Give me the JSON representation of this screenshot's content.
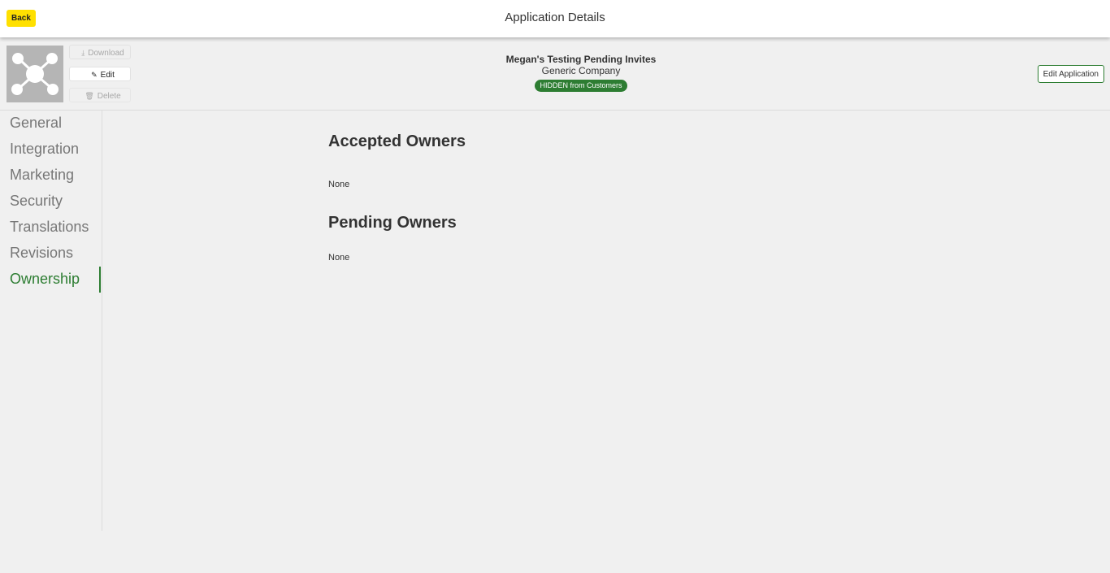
{
  "topbar": {
    "back_label": "Back",
    "title": "Application Details"
  },
  "app": {
    "logo_icon": "network-nodes-icon",
    "name": "Megan's Testing Pending Invites",
    "company": "Generic Company",
    "status": "HIDDEN from Customers",
    "download_label": "Download",
    "edit_label": "Edit",
    "delete_label": "Delete",
    "edit_application_label": "Edit Application"
  },
  "sidebar": {
    "items": [
      {
        "label": "General"
      },
      {
        "label": "Integration"
      },
      {
        "label": "Marketing"
      },
      {
        "label": "Security"
      },
      {
        "label": "Translations"
      },
      {
        "label": "Revisions"
      },
      {
        "label": "Ownership"
      }
    ],
    "active": "Ownership"
  },
  "ownership": {
    "accepted_heading": "Accepted Owners",
    "accepted_value": "None",
    "pending_heading": "Pending Owners",
    "pending_value": "None"
  },
  "colors": {
    "accent": "#2d7d32",
    "back_button": "#ffe000",
    "background": "#f0f0f0"
  }
}
